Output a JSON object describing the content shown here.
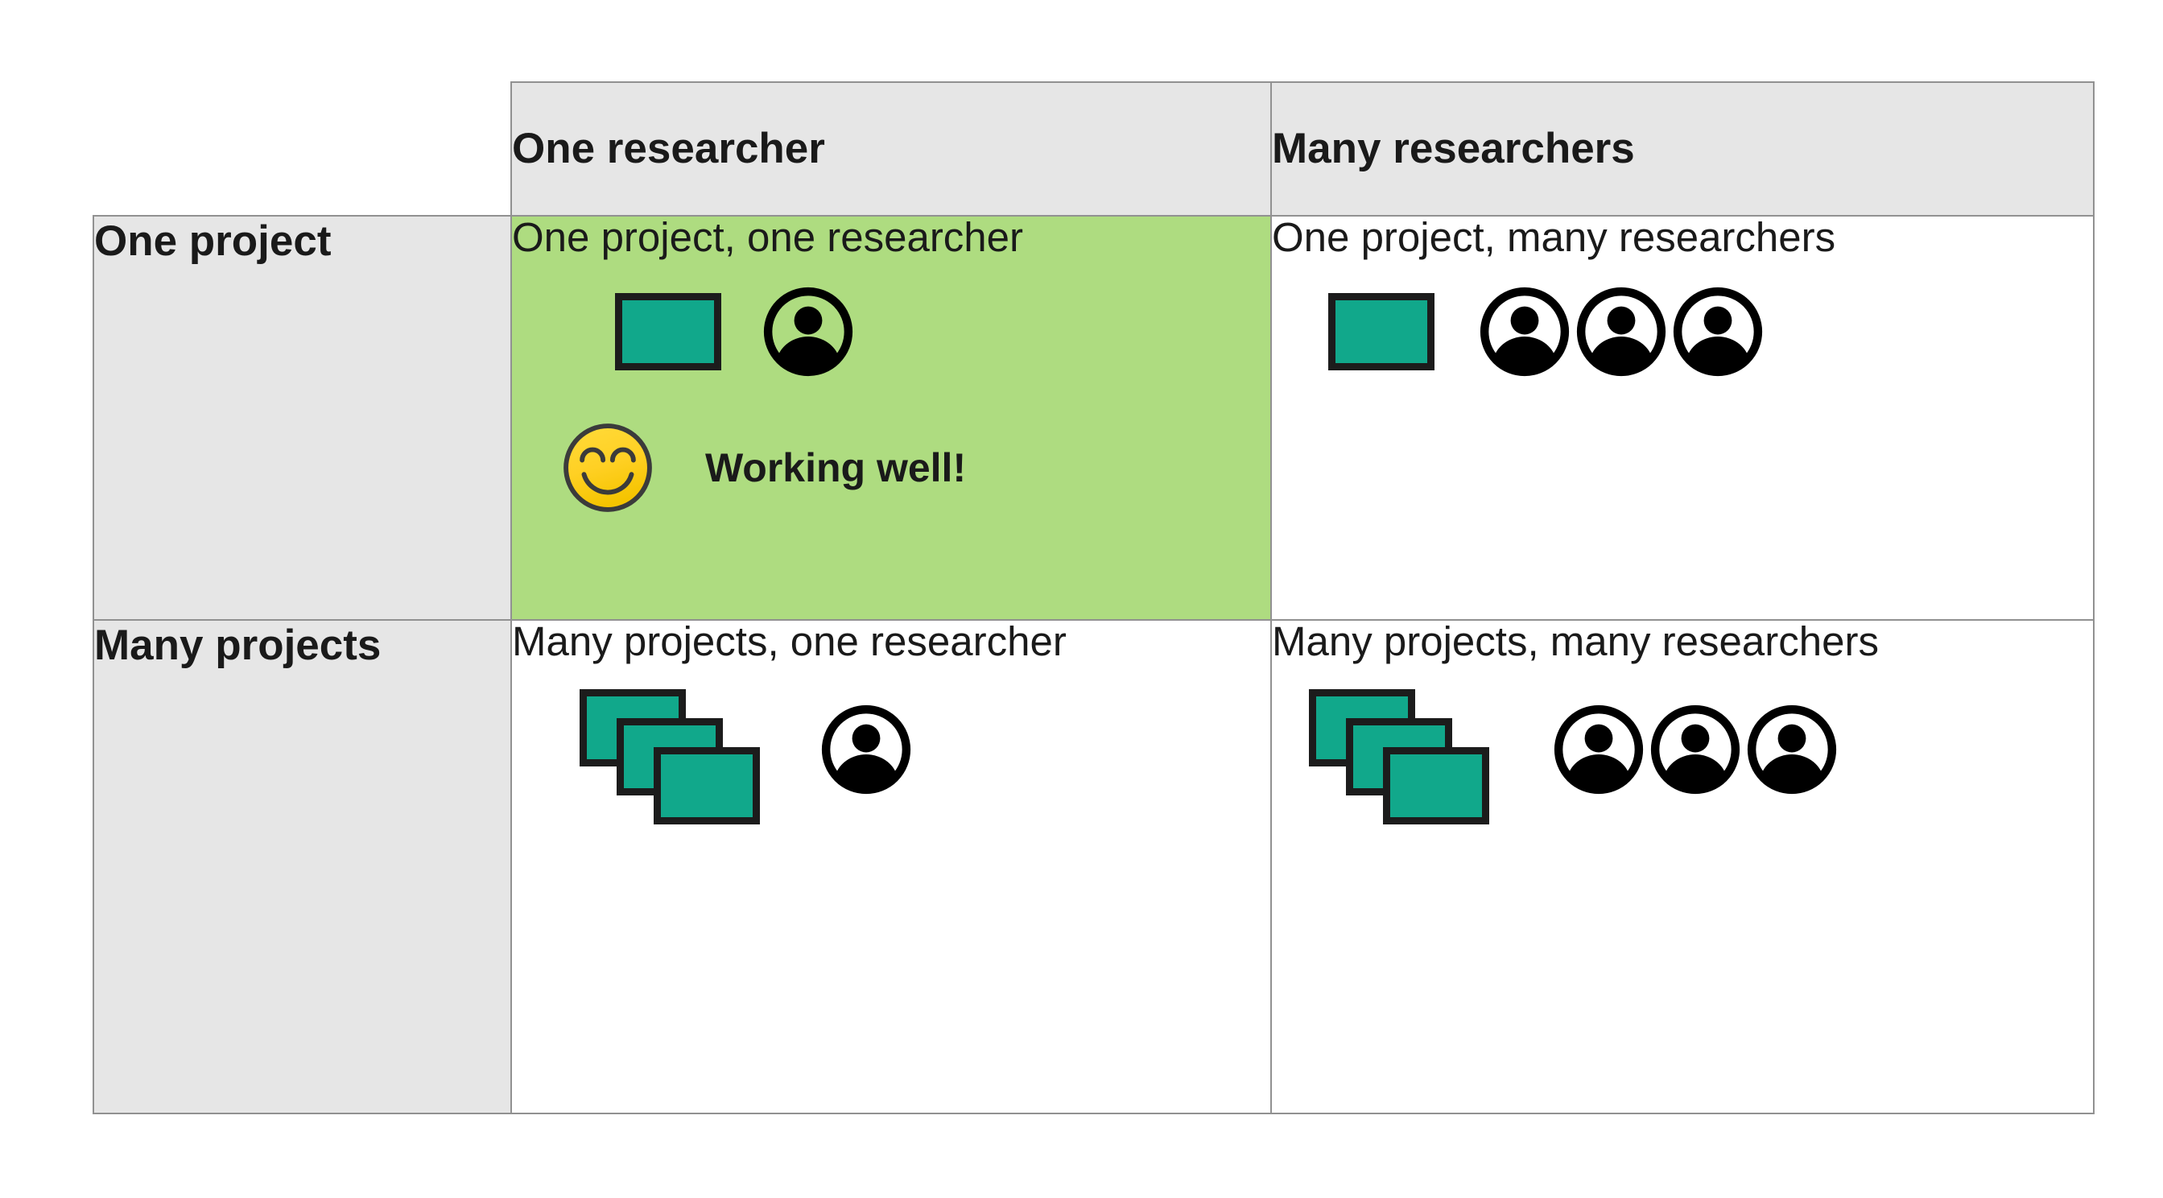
{
  "matrix": {
    "corner_label": "",
    "columns": [
      {
        "key": "one_researcher",
        "label": "One researcher"
      },
      {
        "key": "many_researchers",
        "label": "Many researchers"
      }
    ],
    "rows": [
      {
        "key": "one_project",
        "label": "One project"
      },
      {
        "key": "many_projects",
        "label": "Many projects"
      }
    ],
    "cells": {
      "one_project_one_researcher": {
        "caption": "One project, one researcher",
        "projects": 1,
        "researchers": 1,
        "highlighted": true,
        "status_label": "Working well!",
        "status_icon": "smiling-face-icon"
      },
      "one_project_many_researchers": {
        "caption": "One project, many researchers",
        "projects": 1,
        "researchers": 3,
        "highlighted": false
      },
      "many_projects_one_researcher": {
        "caption": "Many projects, one researcher",
        "projects": 3,
        "researchers": 1,
        "highlighted": false
      },
      "many_projects_many_researchers": {
        "caption": "Many projects, many researchers",
        "projects": 3,
        "researchers": 3,
        "highlighted": false
      }
    }
  },
  "colors": {
    "header_background": "#E6E6E6",
    "highlight_background": "#AEDC80",
    "cell_background": "#FFFFFF",
    "border": "#919191",
    "project_fill": "#11A88B",
    "project_outline": "#1C1C1C",
    "person_fill": "#000000",
    "smiley_fill": "#FFD024",
    "smiley_outline": "#3B3B3B",
    "text": "#1A1A1A"
  },
  "icon_names": {
    "project": "project-rectangle-icon",
    "project_stack": "project-stack-icon",
    "person": "person-avatar-icon",
    "smiley": "smiling-face-icon"
  }
}
